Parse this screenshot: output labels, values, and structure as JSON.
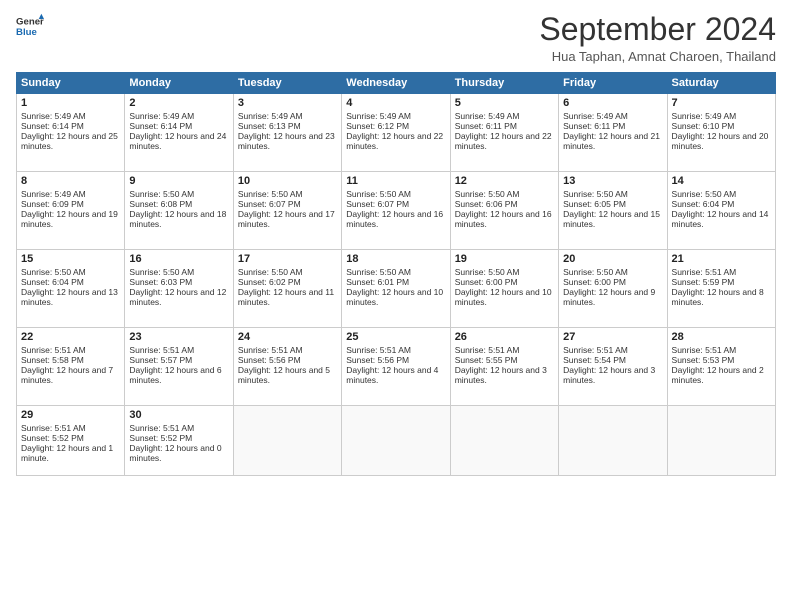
{
  "logo": {
    "line1": "General",
    "line2": "Blue"
  },
  "title": "September 2024",
  "subtitle": "Hua Taphan, Amnat Charoen, Thailand",
  "days_of_week": [
    "Sunday",
    "Monday",
    "Tuesday",
    "Wednesday",
    "Thursday",
    "Friday",
    "Saturday"
  ],
  "weeks": [
    [
      {
        "day": 1,
        "sunrise": "5:49 AM",
        "sunset": "6:14 PM",
        "daylight": "12 hours and 25 minutes."
      },
      {
        "day": 2,
        "sunrise": "5:49 AM",
        "sunset": "6:14 PM",
        "daylight": "12 hours and 24 minutes."
      },
      {
        "day": 3,
        "sunrise": "5:49 AM",
        "sunset": "6:13 PM",
        "daylight": "12 hours and 23 minutes."
      },
      {
        "day": 4,
        "sunrise": "5:49 AM",
        "sunset": "6:12 PM",
        "daylight": "12 hours and 22 minutes."
      },
      {
        "day": 5,
        "sunrise": "5:49 AM",
        "sunset": "6:11 PM",
        "daylight": "12 hours and 22 minutes."
      },
      {
        "day": 6,
        "sunrise": "5:49 AM",
        "sunset": "6:11 PM",
        "daylight": "12 hours and 21 minutes."
      },
      {
        "day": 7,
        "sunrise": "5:49 AM",
        "sunset": "6:10 PM",
        "daylight": "12 hours and 20 minutes."
      }
    ],
    [
      {
        "day": 8,
        "sunrise": "5:49 AM",
        "sunset": "6:09 PM",
        "daylight": "12 hours and 19 minutes."
      },
      {
        "day": 9,
        "sunrise": "5:50 AM",
        "sunset": "6:08 PM",
        "daylight": "12 hours and 18 minutes."
      },
      {
        "day": 10,
        "sunrise": "5:50 AM",
        "sunset": "6:07 PM",
        "daylight": "12 hours and 17 minutes."
      },
      {
        "day": 11,
        "sunrise": "5:50 AM",
        "sunset": "6:07 PM",
        "daylight": "12 hours and 16 minutes."
      },
      {
        "day": 12,
        "sunrise": "5:50 AM",
        "sunset": "6:06 PM",
        "daylight": "12 hours and 16 minutes."
      },
      {
        "day": 13,
        "sunrise": "5:50 AM",
        "sunset": "6:05 PM",
        "daylight": "12 hours and 15 minutes."
      },
      {
        "day": 14,
        "sunrise": "5:50 AM",
        "sunset": "6:04 PM",
        "daylight": "12 hours and 14 minutes."
      }
    ],
    [
      {
        "day": 15,
        "sunrise": "5:50 AM",
        "sunset": "6:04 PM",
        "daylight": "12 hours and 13 minutes."
      },
      {
        "day": 16,
        "sunrise": "5:50 AM",
        "sunset": "6:03 PM",
        "daylight": "12 hours and 12 minutes."
      },
      {
        "day": 17,
        "sunrise": "5:50 AM",
        "sunset": "6:02 PM",
        "daylight": "12 hours and 11 minutes."
      },
      {
        "day": 18,
        "sunrise": "5:50 AM",
        "sunset": "6:01 PM",
        "daylight": "12 hours and 10 minutes."
      },
      {
        "day": 19,
        "sunrise": "5:50 AM",
        "sunset": "6:00 PM",
        "daylight": "12 hours and 10 minutes."
      },
      {
        "day": 20,
        "sunrise": "5:50 AM",
        "sunset": "6:00 PM",
        "daylight": "12 hours and 9 minutes."
      },
      {
        "day": 21,
        "sunrise": "5:51 AM",
        "sunset": "5:59 PM",
        "daylight": "12 hours and 8 minutes."
      }
    ],
    [
      {
        "day": 22,
        "sunrise": "5:51 AM",
        "sunset": "5:58 PM",
        "daylight": "12 hours and 7 minutes."
      },
      {
        "day": 23,
        "sunrise": "5:51 AM",
        "sunset": "5:57 PM",
        "daylight": "12 hours and 6 minutes."
      },
      {
        "day": 24,
        "sunrise": "5:51 AM",
        "sunset": "5:56 PM",
        "daylight": "12 hours and 5 minutes."
      },
      {
        "day": 25,
        "sunrise": "5:51 AM",
        "sunset": "5:56 PM",
        "daylight": "12 hours and 4 minutes."
      },
      {
        "day": 26,
        "sunrise": "5:51 AM",
        "sunset": "5:55 PM",
        "daylight": "12 hours and 3 minutes."
      },
      {
        "day": 27,
        "sunrise": "5:51 AM",
        "sunset": "5:54 PM",
        "daylight": "12 hours and 3 minutes."
      },
      {
        "day": 28,
        "sunrise": "5:51 AM",
        "sunset": "5:53 PM",
        "daylight": "12 hours and 2 minutes."
      }
    ],
    [
      {
        "day": 29,
        "sunrise": "5:51 AM",
        "sunset": "5:52 PM",
        "daylight": "12 hours and 1 minute."
      },
      {
        "day": 30,
        "sunrise": "5:51 AM",
        "sunset": "5:52 PM",
        "daylight": "12 hours and 0 minutes."
      },
      null,
      null,
      null,
      null,
      null
    ]
  ]
}
